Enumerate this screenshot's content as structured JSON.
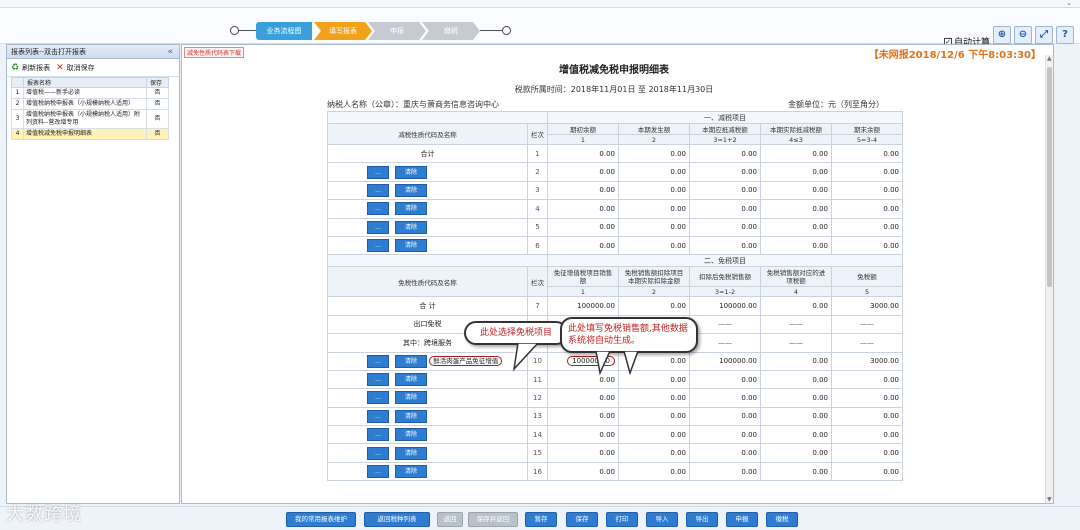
{
  "top": {
    "flow_steps": [
      "业务流程图",
      "填写报表",
      "申报",
      "缴税"
    ],
    "auto_calc_label": "自动计算",
    "tool_icons": [
      "zoom-in-icon",
      "zoom-out-icon",
      "fullscreen-icon",
      "help-icon"
    ]
  },
  "sidebar": {
    "title": "报表列表--双击打开报表",
    "refresh_label": "刷新报表",
    "cancel_save_label": "取消保存",
    "col_name": "报表名称",
    "col_save": "保存",
    "rows": [
      {
        "n": "1",
        "name": "增值税——新手必读",
        "save": "否"
      },
      {
        "n": "2",
        "name": "增值税纳税申报表（小规模纳税人适用）",
        "save": "否"
      },
      {
        "n": "3",
        "name": "增值税纳税申报表（小规模纳税人适用）附列资料--营改增专用",
        "save": "否"
      },
      {
        "n": "4",
        "name": "增值税减免税申报明细表",
        "save": "否"
      }
    ]
  },
  "main": {
    "red_link": "减免性质代码表下载",
    "status": "【未网报2018/12/6 下午8:03:30】",
    "title": "增值税减免税申报明细表",
    "period": "税款所属时间：2018年11月01日 至 2018年11月30日",
    "taxpayer": "纳税人名称（公章）：重庆与萧商务信息咨询中心",
    "unit": "金额单位：元（列至角分）"
  },
  "section1": {
    "title": "一、减税项目",
    "h_code": "减税性质代码及名称",
    "h_row": "栏次",
    "cols": [
      "期初余额",
      "本期发生额",
      "本期应抵减税额",
      "本期实际抵减税额",
      "期末余额"
    ],
    "idx": [
      "1",
      "2",
      "3=1+2",
      "4≤3",
      "5=3-4"
    ],
    "total_label": "合计",
    "rows": [
      {
        "r": "1",
        "v": [
          "0.00",
          "0.00",
          "0.00",
          "0.00",
          "0.00"
        ]
      },
      {
        "r": "2",
        "v": [
          "0.00",
          "0.00",
          "0.00",
          "0.00",
          "0.00"
        ]
      },
      {
        "r": "3",
        "v": [
          "0.00",
          "0.00",
          "0.00",
          "0.00",
          "0.00"
        ]
      },
      {
        "r": "4",
        "v": [
          "0.00",
          "0.00",
          "0.00",
          "0.00",
          "0.00"
        ]
      },
      {
        "r": "5",
        "v": [
          "0.00",
          "0.00",
          "0.00",
          "0.00",
          "0.00"
        ]
      },
      {
        "r": "6",
        "v": [
          "0.00",
          "0.00",
          "0.00",
          "0.00",
          "0.00"
        ]
      }
    ]
  },
  "section2": {
    "title": "二、免税项目",
    "h_code": "免税性质代码及名称",
    "h_row": "栏次",
    "cols": [
      "免征增值税项目销售额",
      "免税销售额扣除项目本期实际扣除金额",
      "扣除后免税销售额",
      "免税销售额对应的进项税额",
      "免税额"
    ],
    "idx": [
      "1",
      "2",
      "3=1-2",
      "4",
      "5"
    ],
    "total": {
      "label": "合 计",
      "r": "7",
      "v": [
        "100000.00",
        "0.00",
        "100000.00",
        "0.00",
        "3000.00"
      ]
    },
    "export": {
      "label": "出口免税",
      "r": "8",
      "v": [
        "0.00",
        "——",
        "——",
        "——",
        "——"
      ]
    },
    "crossborder": {
      "label": "其中：跨境服务",
      "r": "9",
      "v": [
        "0.00",
        "——",
        "——",
        "——",
        "——"
      ]
    },
    "row10": {
      "item": "鲜活肉蛋产品免征增值",
      "r": "10",
      "v": [
        "100000.00",
        "0.00",
        "100000.00",
        "0.00",
        "3000.00"
      ]
    },
    "rows": [
      {
        "r": "11",
        "v": [
          "0.00",
          "0.00",
          "0.00",
          "0.00",
          "0.00"
        ]
      },
      {
        "r": "12",
        "v": [
          "0.00",
          "0.00",
          "0.00",
          "0.00",
          "0.00"
        ]
      },
      {
        "r": "13",
        "v": [
          "0.00",
          "0.00",
          "0.00",
          "0.00",
          "0.00"
        ]
      },
      {
        "r": "14",
        "v": [
          "0.00",
          "0.00",
          "0.00",
          "0.00",
          "0.00"
        ]
      },
      {
        "r": "15",
        "v": [
          "0.00",
          "0.00",
          "0.00",
          "0.00",
          "0.00"
        ]
      },
      {
        "r": "16",
        "v": [
          "0.00",
          "0.00",
          "0.00",
          "0.00",
          "0.00"
        ]
      }
    ]
  },
  "buttons": {
    "dots": "...",
    "clear": "清除"
  },
  "callouts": {
    "select": "此处选择免税项目",
    "fill": "此处填写免税销售额,其他数据系统将自动生成。"
  },
  "bottom": [
    {
      "label": "我的常用报表维护",
      "enabled": true
    },
    {
      "label": "返回税种列表",
      "enabled": true
    },
    {
      "label": "返回",
      "enabled": false
    },
    {
      "label": "保存并返回",
      "enabled": false
    },
    {
      "label": "暂存",
      "enabled": true
    },
    {
      "label": "保存",
      "enabled": true
    },
    {
      "label": "打印",
      "enabled": true
    },
    {
      "label": "导入",
      "enabled": true
    },
    {
      "label": "导出",
      "enabled": true
    },
    {
      "label": "申报",
      "enabled": true
    },
    {
      "label": "缴税",
      "enabled": true
    }
  ],
  "watermark": "大数跨境"
}
